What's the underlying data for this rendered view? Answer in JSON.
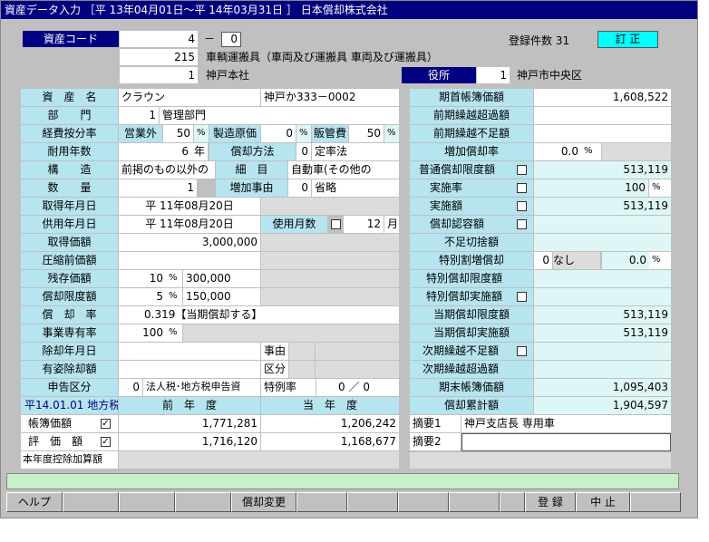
{
  "window": {
    "title": "資産データ入力 ［平 13年04月01日～平 14年03月31日 ］ 日本償却株式会社"
  },
  "header": {
    "asset_code_label": "資産コード",
    "asset_code": "4",
    "dash": "－",
    "asset_sub": "0",
    "count_label": "登録件数 31",
    "mode": "訂 正",
    "account_label": "科目コード",
    "account_code": "215",
    "account_name": "車輌運搬具（車両及び運搬具 車両及び運搬具）",
    "office_label": "事業所コード",
    "office_code": "1",
    "office_name": "神戸本社",
    "yakusho_label": "役所",
    "yakusho_code": "1",
    "yakusho_name": "神戸市中央区"
  },
  "left": {
    "name_label": "資　産　名",
    "name": "クラウン",
    "name2": "神戸か333－0002",
    "dept_label": "部　　門",
    "dept_code": "1",
    "dept_name": "管理部門",
    "alloc_label": "経費按分率",
    "alloc1_label": "営業外",
    "alloc1": "50",
    "pct": "%",
    "alloc2_label": "製造原価",
    "alloc2": "0",
    "alloc3_label": "販管費",
    "alloc3": "50",
    "life_label": "耐用年数",
    "life": "6",
    "life_unit": "年",
    "method_label": "償却方法",
    "method_code": "0",
    "method_name": "定率法",
    "struct_label": "構　　造",
    "struct": "前掲のもの以外の",
    "detail_label": "細　目",
    "detail": "自動車(その他の",
    "qty_label": "数　　量",
    "qty": "1",
    "increase_label": "増加事由",
    "increase_code": "0",
    "increase_name": "省略",
    "acq_date_label": "取得年月日",
    "acq_date": "平 11年08月20日",
    "use_date_label": "供用年月日",
    "use_date": "平 11年08月20日",
    "use_months_label": "使用月数",
    "use_months": "12",
    "month_unit": "月",
    "acq_price_label": "取得価額",
    "acq_price": "3,000,000",
    "compress_label": "圧縮前価額",
    "residual_label": "残存価額",
    "residual_pct": "10",
    "residual": "300,000",
    "limit_label": "償却限度額",
    "limit_pct": "5",
    "limit": "150,000",
    "rate_label": "償　却　率",
    "rate": "0.319",
    "rate_note": "【当期償却する】",
    "biz_label": "事業専有率",
    "biz": "100",
    "disposal_label": "除却年月日",
    "reason_label": "事由",
    "paid_label": "有姿除却額",
    "kubun_label": "区分",
    "report_label": "申告区分",
    "report_code": "0",
    "report_name": "法人税･地方税申告資",
    "special_label": "特例率",
    "special_a": "0",
    "slash": "／",
    "special_b": "0",
    "hist_label": "平14.01.01 地方税",
    "prev_year_label": "前　年　度",
    "cur_year_label": "当　年　度",
    "book_label": "帳簿価額",
    "book_prev": "1,771,281",
    "book_cur": "1,206,242",
    "eval_label": "評　価　額",
    "eval_prev": "1,716,120",
    "eval_cur": "1,168,677",
    "deduct_label": "本年度控除加算額"
  },
  "right": {
    "begin_label": "期首帳簿価額",
    "begin": "1,608,522",
    "carry_over_label": "前期繰越超過額",
    "carry_short_label": "前期繰越不足額",
    "add_rate_label": "増加償却率",
    "add_rate": "0.0",
    "pct": "%",
    "normal_limit_label": "普通償却限度額",
    "normal_limit": "513,119",
    "impl_rate_label": "実施率",
    "impl_rate": "100",
    "impl_amount_label": "実施額",
    "impl_amount": "513,119",
    "approve_label": "償却認容額",
    "shortfall_label": "不足切捨額",
    "special_label": "特別割増償却",
    "special_code": "0",
    "special_name": "なし",
    "special_rate": "0.0",
    "sp_limit_label": "特別償却限度額",
    "sp_impl_label": "特別償却実施額",
    "cur_limit_label": "当期償却限度額",
    "cur_limit": "513,119",
    "cur_impl_label": "当期償却実施額",
    "cur_impl": "513,119",
    "next_short_label": "次期繰越不足額",
    "next_over_label": "次期繰越超過額",
    "end_label": "期末帳簿価額",
    "end": "1,095,403",
    "accum_label": "償却累計額",
    "accum": "1,904,597",
    "memo1_label": "摘要1",
    "memo1": "神戸支店長 専用車",
    "memo2_label": "摘要2",
    "memo2": ""
  },
  "footer": {
    "help": "ヘルプ",
    "depr_change": "償却変更",
    "register": "登 録",
    "cancel": "中 止"
  }
}
